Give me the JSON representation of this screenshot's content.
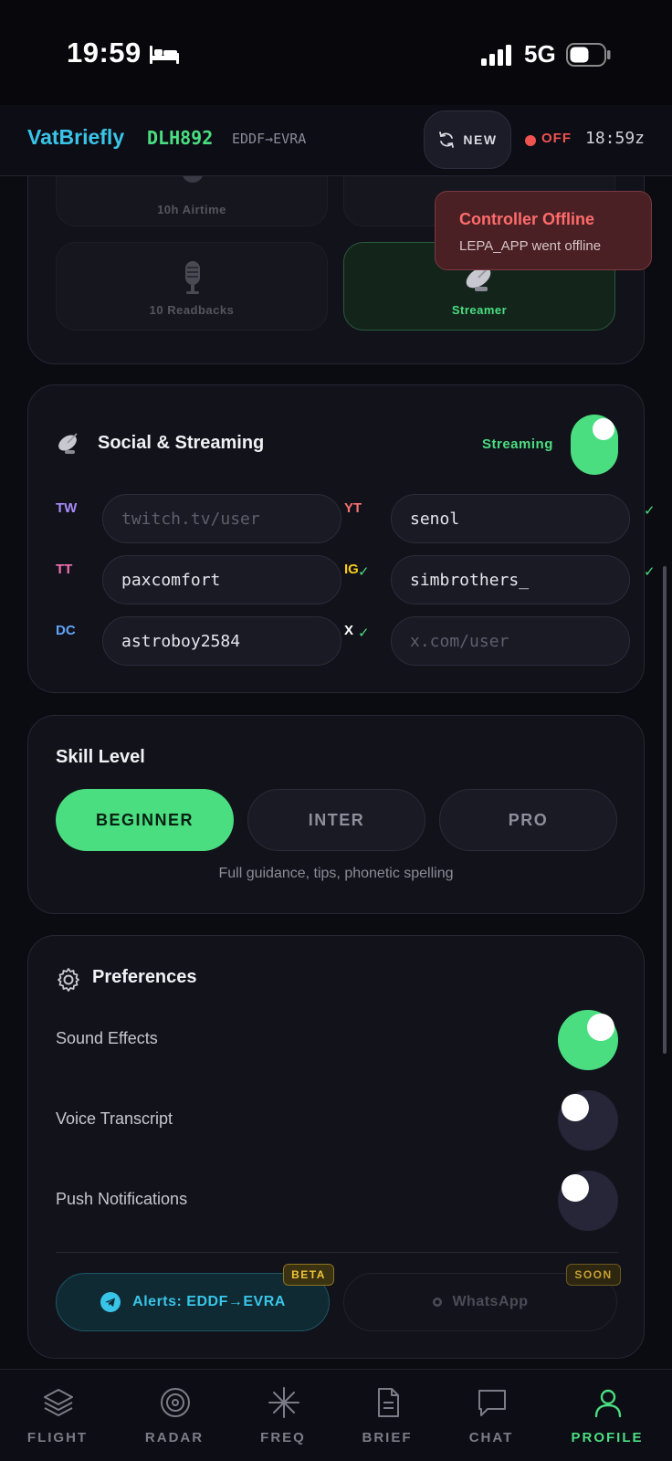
{
  "status_bar": {
    "time": "19:59",
    "network": "5G"
  },
  "header": {
    "app_title": "VatBriefly",
    "callsign": "DLH892",
    "route": "EDDF→EVRA",
    "new_label": "NEW",
    "status_label": "OFF",
    "zulu_time": "18:59z"
  },
  "achievements": {
    "tiles": [
      {
        "label": "10h Airtime",
        "icon": "headset-icon",
        "earned": false
      },
      {
        "label": "",
        "icon": "radio-icon",
        "earned": false
      },
      {
        "label": "10 Readbacks",
        "icon": "microphone-icon",
        "earned": false
      },
      {
        "label": "Streamer",
        "icon": "satellite-dish-icon",
        "earned": true
      }
    ]
  },
  "toast": {
    "title": "Controller Offline",
    "message": "LEPA_APP went offline"
  },
  "social": {
    "title": "Social & Streaming",
    "streaming_label": "Streaming",
    "streaming_on": true,
    "fields": [
      {
        "platform": "TW",
        "color": "#a78bfa",
        "value": "",
        "placeholder": "twitch.tv/user",
        "verified": false
      },
      {
        "platform": "YT",
        "color": "#f87171",
        "value": "senol",
        "placeholder": "",
        "verified": true
      },
      {
        "platform": "TT",
        "color": "#f472b6",
        "value": "paxcomfort",
        "placeholder": "",
        "verified": false
      },
      {
        "platform": "IG",
        "color": "#facc15",
        "value": "simbrothers_",
        "placeholder": "",
        "verified": true
      },
      {
        "platform": "DC",
        "color": "#60a5fa",
        "value": "astroboy2584",
        "placeholder": "",
        "verified": false
      },
      {
        "platform": "X",
        "color": "#ffffff",
        "value": "",
        "placeholder": "x.com/user",
        "verified": false
      }
    ]
  },
  "skill": {
    "title": "Skill Level",
    "options": [
      "BEGINNER",
      "INTER",
      "PRO"
    ],
    "selected": "BEGINNER",
    "description": "Full guidance, tips, phonetic spelling"
  },
  "preferences": {
    "title": "Preferences",
    "items": [
      {
        "label": "Sound Effects",
        "on": true
      },
      {
        "label": "Voice Transcript",
        "on": false
      },
      {
        "label": "Push Notifications",
        "on": false
      }
    ],
    "alerts_label": "Alerts: EDDF→EVRA",
    "alerts_badge": "BETA",
    "whatsapp_label": "WhatsApp",
    "whatsapp_badge": "SOON"
  },
  "nav": {
    "items": [
      {
        "label": "FLIGHT",
        "icon": "layers-icon"
      },
      {
        "label": "RADAR",
        "icon": "radar-icon"
      },
      {
        "label": "FREQ",
        "icon": "frequency-icon"
      },
      {
        "label": "BRIEF",
        "icon": "document-icon"
      },
      {
        "label": "CHAT",
        "icon": "chat-icon"
      },
      {
        "label": "PROFILE",
        "icon": "user-icon"
      }
    ],
    "active": "PROFILE"
  },
  "colors": {
    "accent_green": "#4ade80",
    "accent_cyan": "#39c5e8",
    "alert_red": "#ef5350"
  }
}
